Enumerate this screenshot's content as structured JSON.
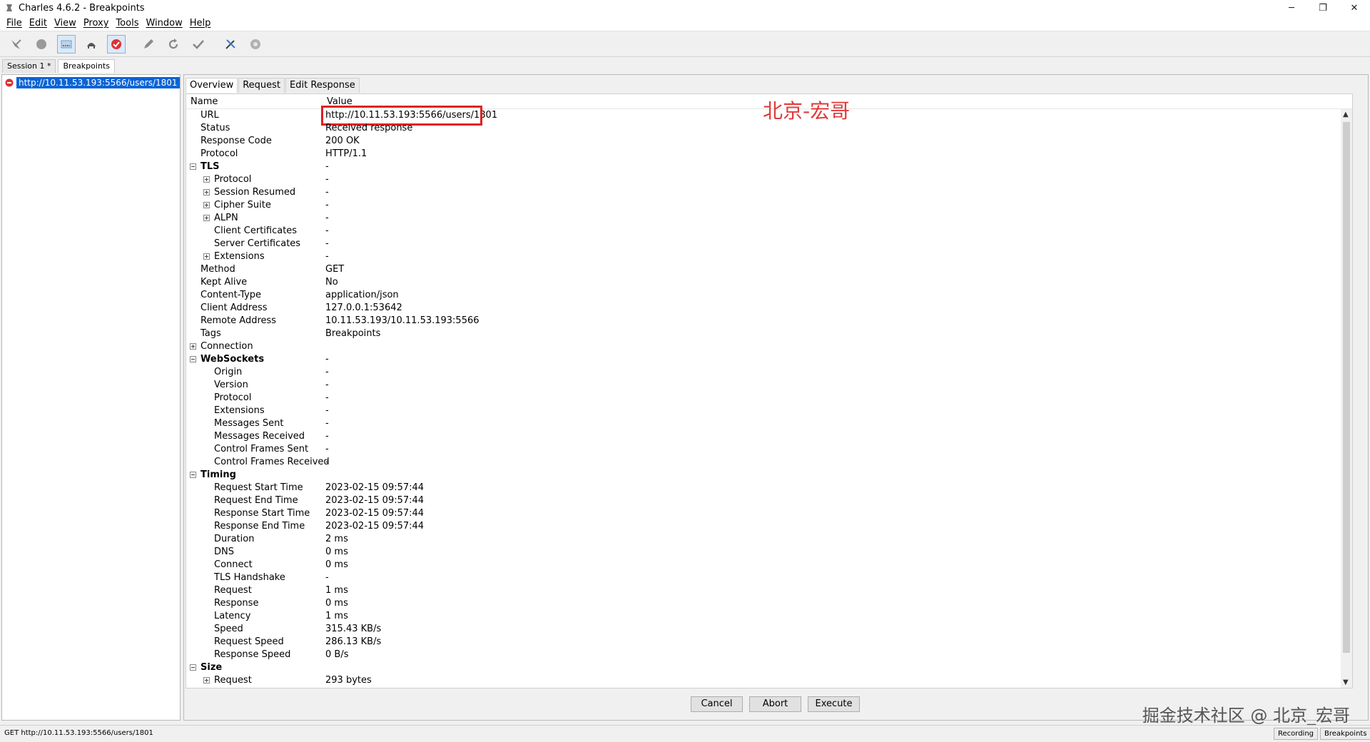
{
  "window": {
    "title": "Charles 4.6.2 - Breakpoints",
    "minimize": "─",
    "restore": "❐",
    "close": "✕"
  },
  "menu": [
    "File",
    "Edit",
    "View",
    "Proxy",
    "Tools",
    "Window",
    "Help"
  ],
  "toolbar": {
    "icons": [
      "broom-icon",
      "record-icon",
      "throttle-icon",
      "turtle-icon",
      "breakpoint-icon",
      "pen-icon",
      "refresh-icon",
      "check-icon",
      "tools-icon",
      "settings-icon"
    ]
  },
  "session_tabs": [
    "Session 1 *",
    "Breakpoints"
  ],
  "tree": {
    "selected_url": "http://10.11.53.193:5566/users/1801"
  },
  "detail_tabs": [
    "Overview",
    "Request",
    "Edit Response"
  ],
  "table": {
    "col_name": "Name",
    "col_value": "Value",
    "rows": [
      {
        "name": "URL",
        "value": "http://10.11.53.193:5566/users/1801"
      },
      {
        "name": "Status",
        "value": "Received response"
      },
      {
        "name": "Response Code",
        "value": "200 OK"
      },
      {
        "name": "Protocol",
        "value": "HTTP/1.1"
      },
      {
        "name": "TLS",
        "value": "-"
      },
      {
        "name": "Protocol",
        "value": "-"
      },
      {
        "name": "Session Resumed",
        "value": "-"
      },
      {
        "name": "Cipher Suite",
        "value": "-"
      },
      {
        "name": "ALPN",
        "value": "-"
      },
      {
        "name": "Client Certificates",
        "value": "-"
      },
      {
        "name": "Server Certificates",
        "value": "-"
      },
      {
        "name": "Extensions",
        "value": "-"
      },
      {
        "name": "Method",
        "value": "GET"
      },
      {
        "name": "Kept Alive",
        "value": "No"
      },
      {
        "name": "Content-Type",
        "value": "application/json"
      },
      {
        "name": "Client Address",
        "value": "127.0.0.1:53642"
      },
      {
        "name": "Remote Address",
        "value": "10.11.53.193/10.11.53.193:5566"
      },
      {
        "name": "Tags",
        "value": "Breakpoints"
      },
      {
        "name": "Connection",
        "value": ""
      },
      {
        "name": "WebSockets",
        "value": "-"
      },
      {
        "name": "Origin",
        "value": "-"
      },
      {
        "name": "Version",
        "value": "-"
      },
      {
        "name": "Protocol",
        "value": "-"
      },
      {
        "name": "Extensions",
        "value": "-"
      },
      {
        "name": "Messages Sent",
        "value": "-"
      },
      {
        "name": "Messages Received",
        "value": "-"
      },
      {
        "name": "Control Frames Sent",
        "value": "-"
      },
      {
        "name": "Control Frames Received",
        "value": "-"
      },
      {
        "name": "Timing",
        "value": ""
      },
      {
        "name": "Request Start Time",
        "value": "2023-02-15 09:57:44"
      },
      {
        "name": "Request End Time",
        "value": "2023-02-15 09:57:44"
      },
      {
        "name": "Response Start Time",
        "value": "2023-02-15 09:57:44"
      },
      {
        "name": "Response End Time",
        "value": "2023-02-15 09:57:44"
      },
      {
        "name": "Duration",
        "value": "2 ms"
      },
      {
        "name": "DNS",
        "value": "0 ms"
      },
      {
        "name": "Connect",
        "value": "0 ms"
      },
      {
        "name": "TLS Handshake",
        "value": "-"
      },
      {
        "name": "Request",
        "value": "1 ms"
      },
      {
        "name": "Response",
        "value": "0 ms"
      },
      {
        "name": "Latency",
        "value": "1 ms"
      },
      {
        "name": "Speed",
        "value": "315.43 KB/s"
      },
      {
        "name": "Request Speed",
        "value": "286.13 KB/s"
      },
      {
        "name": "Response Speed",
        "value": "0 B/s"
      },
      {
        "name": "Size",
        "value": ""
      },
      {
        "name": "Request",
        "value": "293 bytes"
      }
    ]
  },
  "annotation_text": "北京-宏哥",
  "buttons": {
    "cancel": "Cancel",
    "abort": "Abort",
    "execute": "Execute"
  },
  "corner_watermark": "掘金技术社区 @ 北京_宏哥",
  "statusbar": {
    "text": "GET http://10.11.53.193:5566/users/1801",
    "recording": "Recording",
    "breakpoints": "Breakpoints"
  },
  "colors": {
    "selection": "#0a64d6",
    "highlight_box": "#e02020",
    "annotation": "#e03a3a"
  }
}
